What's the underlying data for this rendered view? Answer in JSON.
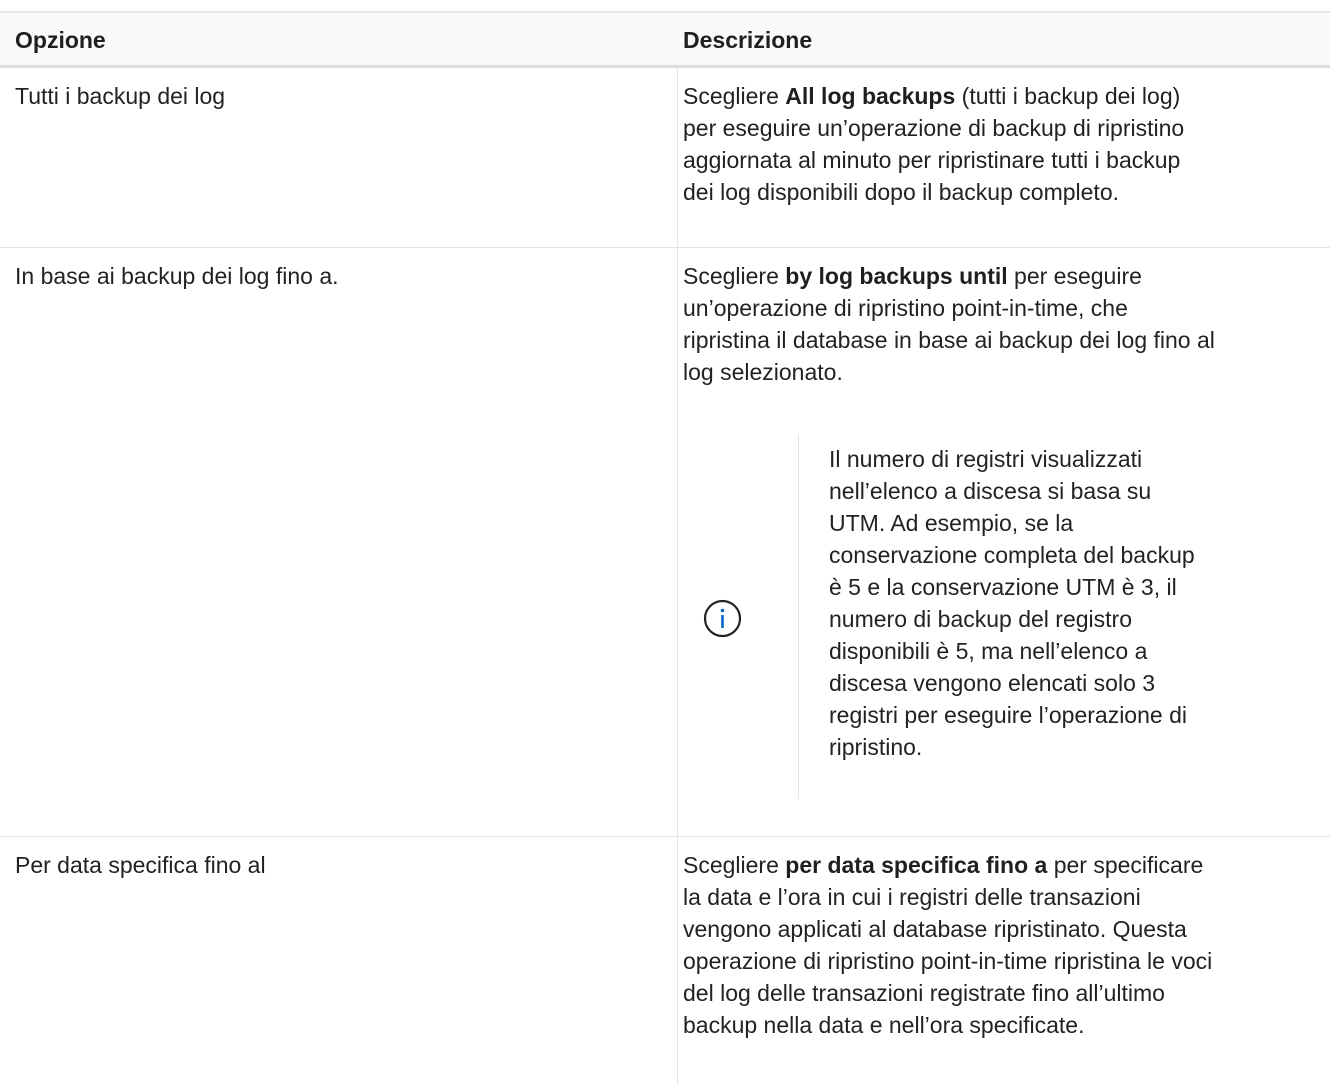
{
  "table": {
    "headers": {
      "option": "Opzione",
      "description": "Descrizione"
    },
    "rows": [
      {
        "option": "Tutti i backup dei log",
        "description": {
          "prefix": "Scegliere ",
          "bold": "All log backups",
          "line1_rest": " (tutti i backup dei log)",
          "lines": [
            "per eseguire un’operazione di backup di ripristino",
            "aggiornata al minuto per ripristinare tutti i backup",
            "dei log disponibili dopo il backup completo."
          ]
        }
      },
      {
        "option": "In base ai backup dei log fino a.",
        "description": {
          "prefix": "Scegliere ",
          "bold": "by log backups until",
          "line1_rest": " per eseguire",
          "lines": [
            "un’operazione di ripristino point-in-time, che",
            "ripristina il database in base ai backup dei log fino al",
            "log selezionato."
          ]
        },
        "note": {
          "icon": "info-circle-icon",
          "icon_color": "#0067c5",
          "lines": [
            "Il numero di registri visualizzati",
            "nell’elenco a discesa si basa su",
            "UTM. Ad esempio, se la",
            "conservazione completa del backup",
            "è 5 e la conservazione UTM è 3, il",
            "numero di backup del registro",
            "disponibili è 5, ma nell’elenco a",
            "discesa vengono elencati solo 3",
            "registri per eseguire l’operazione di",
            "ripristino."
          ]
        }
      },
      {
        "option": "Per data specifica fino al",
        "description": {
          "prefix": "Scegliere ",
          "bold": "per data specifica fino a",
          "line1_rest": " per specificare",
          "lines": [
            "la data e l’ora in cui i registri delle transazioni",
            "vengono applicati al database ripristinato. Questa",
            "operazione di ripristino point-in-time ripristina le voci",
            "del log delle transazioni registrate fino all’ultimo",
            "backup nella data e nell’ora specificate."
          ]
        }
      }
    ]
  }
}
